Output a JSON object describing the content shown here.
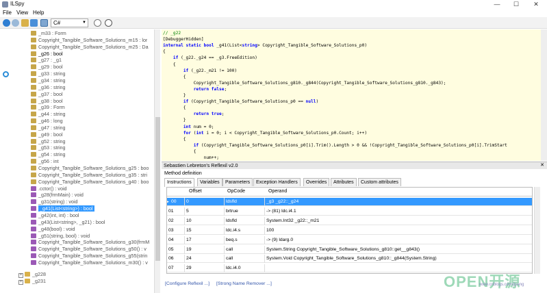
{
  "window": {
    "title": "ILSpy",
    "minimize": "—",
    "maximize": "☐",
    "close": "✕"
  },
  "menu": [
    "File",
    "View",
    "Help"
  ],
  "toolbar": {
    "language": "C#"
  },
  "tree": {
    "items": [
      {
        "label": "_m33 : Form",
        "type": "field"
      },
      {
        "label": "Copyright_Tangible_Software_Solutions_m15 : lor",
        "type": "field"
      },
      {
        "label": "Copyright_Tangible_Software_Solutions_m25 : Da",
        "type": "field"
      },
      {
        "label": "_g26 : bool",
        "type": "field",
        "bold": true
      },
      {
        "label": "_g27 : _g1",
        "type": "field"
      },
      {
        "label": "_g29 : bool",
        "type": "field"
      },
      {
        "label": "_g33 : string",
        "type": "field"
      },
      {
        "label": "_g34 : string",
        "type": "field"
      },
      {
        "label": "_g36 : string",
        "type": "field"
      },
      {
        "label": "_g37 : bool",
        "type": "field"
      },
      {
        "label": "_g38 : bool",
        "type": "field"
      },
      {
        "label": "_g39 : Form",
        "type": "field"
      },
      {
        "label": "_g44 : string",
        "type": "field"
      },
      {
        "label": "_g46 : long",
        "type": "field"
      },
      {
        "label": "_g47 : string",
        "type": "field"
      },
      {
        "label": "_g49 : bool",
        "type": "field"
      },
      {
        "label": "_g52 : string",
        "type": "field"
      },
      {
        "label": "_g53 : string",
        "type": "field"
      },
      {
        "label": "_g54 : string",
        "type": "field"
      },
      {
        "label": "_g56 : int",
        "type": "field"
      },
      {
        "label": "Copyright_Tangible_Software_Solutions_g25 : boo",
        "type": "field"
      },
      {
        "label": "Copyright_Tangible_Software_Solutions_g35 : stri",
        "type": "field"
      },
      {
        "label": "Copyright_Tangible_Software_Solutions_g40 : boo",
        "type": "field"
      },
      {
        "label": ".cctor() : void",
        "type": "method"
      },
      {
        "label": "_g28(frmMain) : void",
        "type": "method"
      },
      {
        "label": "_g31(string) : void",
        "type": "method"
      },
      {
        "label": "_g41(List<string>) : bool",
        "type": "method",
        "selected": true
      },
      {
        "label": "_g42(int, int) : bool",
        "type": "method"
      },
      {
        "label": "_g43(List<string>, _g21) : bool",
        "type": "method"
      },
      {
        "label": "_g48(bool) : void",
        "type": "method"
      },
      {
        "label": "_g51(string, bool) : void",
        "type": "method"
      },
      {
        "label": "Copyright_Tangible_Software_Solutions_g30(frmM",
        "type": "method"
      },
      {
        "label": "Copyright_Tangible_Software_Solutions_g50() : v",
        "type": "method"
      },
      {
        "label": "Copyright_Tangible_Software_Solutions_g55(strin",
        "type": "method"
      },
      {
        "label": "Copyright_Tangible_Software_Solutions_m30() : v",
        "type": "method"
      }
    ],
    "nodes": [
      "_g228",
      "_g231"
    ]
  },
  "code": {
    "lines": [
      "// _g22",
      "[DebuggerHidden]",
      "internal static bool _g41(List<string> Copyright_Tangible_Software_Solutions_p0)",
      "{",
      "    if (_g22._g24 == _g3.FreeEdition)",
      "    {",
      "        if (_g22._m21 != 100)",
      "        {",
      "            Copyright_Tangible_Software_Solutions_g810._g844(Copyright_Tangible_Software_Solutions_g810._g843);",
      "            return false;",
      "        }",
      "        if (Copyright_Tangible_Software_Solutions_p0 == null)",
      "        {",
      "            return true;",
      "        }",
      "        int num = 0;",
      "        for (int i = 0; i < Copyright_Tangible_Software_Solutions_p0.Count; i++)",
      "        {",
      "            if (Copyright_Tangible_Software_Solutions_p0[i].Trim().Length > 0 && !Copyright_Tangible_Software_Solutions_p0[i].TrimStart",
      "            {",
      "                num++;"
    ]
  },
  "reflexil": {
    "title": "Sebastien Lebreton's Reflexil v2.0",
    "close": "✕",
    "method_definition": "Method definition",
    "tabs": [
      "Instructions",
      "Variables",
      "Parameters",
      "Exception Handlers",
      "Overrides",
      "Attributes",
      "Custom attributes"
    ],
    "columns": [
      "Offset",
      "OpCode",
      "Operand"
    ],
    "rows": [
      {
        "index": "00",
        "offset": "0",
        "opcode": "ldsfld",
        "operand": "_g3 _g22::_g24",
        "selected": true
      },
      {
        "index": "01",
        "offset": "5",
        "opcode": "brtrue",
        "operand": "-> (81) ldc.i4.1"
      },
      {
        "index": "02",
        "offset": "10",
        "opcode": "ldsfld",
        "operand": "System.Int32 _g22::_m21"
      },
      {
        "index": "03",
        "offset": "15",
        "opcode": "ldc.i4.s",
        "operand": "100"
      },
      {
        "index": "04",
        "offset": "17",
        "opcode": "beq.s",
        "operand": "-> (9) ldarg.0"
      },
      {
        "index": "05",
        "offset": "19",
        "opcode": "call",
        "operand": "System.String Copyright_Tangible_Software_Solutions_g810::get__g843()"
      },
      {
        "index": "06",
        "offset": "24",
        "opcode": "call",
        "operand": "System.Void Copyright_Tangible_Software_Solutions_g810::_g844(System.String)"
      },
      {
        "index": "07",
        "offset": "29",
        "opcode": "ldc.i4.0",
        "operand": ""
      }
    ],
    "footer_configure": "[Configure Reflexil ...]",
    "footer_remover": "[Strong Name Remover ...]"
  },
  "watermark": {
    "text": "OPEN开源",
    "url": "www.cnblogs.com/jiyang"
  },
  "colors": {
    "selection": "#3399ff",
    "code_bg": "#fffde0",
    "keyword": "#0000ff",
    "comment": "#008000"
  }
}
